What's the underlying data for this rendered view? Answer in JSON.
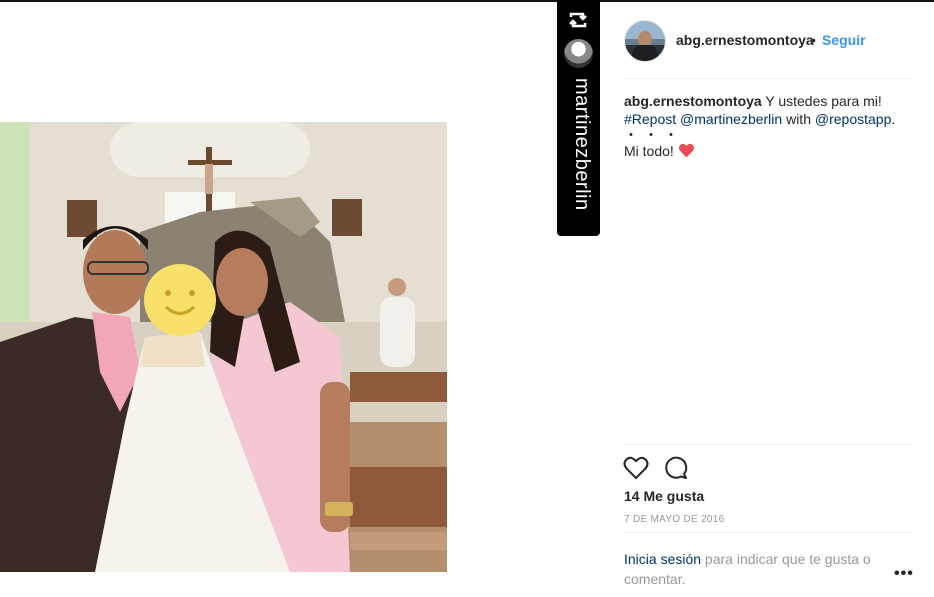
{
  "repost": {
    "icon": "repost-icon",
    "username": "martinezberlin"
  },
  "post": {
    "username": "abg.ernestomontoya",
    "separator": "•",
    "follow_label": "Seguir",
    "caption": {
      "author": "abg.ernestomontoya",
      "text": " Y ustedes para mi!",
      "hashtag": "#Repost",
      "mention1": "@martinezberlin",
      "with_text": " with ",
      "mention2": "@repostapp",
      "period": ".",
      "dots": "・・・",
      "line3": "Mi todo! "
    },
    "likes": "14 Me gusta",
    "date": "7 DE MAYO DE 2016",
    "login_link": "Inicia sesión",
    "login_text": " para indicar que te gusta o comentar.",
    "more": "•••"
  },
  "colors": {
    "link": "#3897f0",
    "tag": "#003569",
    "muted": "#999999",
    "heart": "#ed4956"
  }
}
